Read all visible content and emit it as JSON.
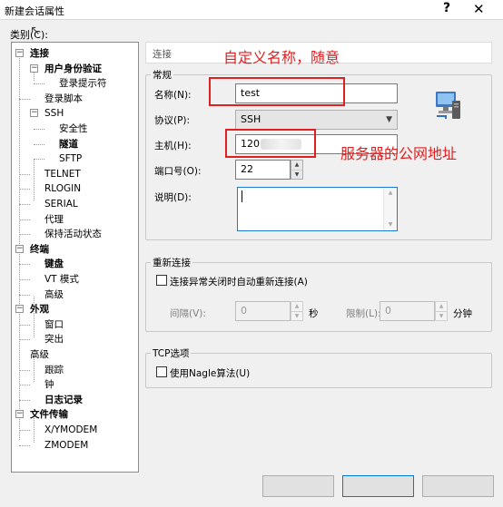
{
  "window": {
    "title": "新建会话属性",
    "help_glyph": "?",
    "close_glyph": "✕"
  },
  "category_label": "类别(C):",
  "tree": {
    "items": [
      {
        "label": "连接",
        "bold": true
      },
      {
        "label": "用户身份验证",
        "bold": true
      },
      {
        "label": "登录提示符",
        "bold": false
      },
      {
        "label": "登录脚本",
        "bold": false
      },
      {
        "label": "SSH",
        "bold": false
      },
      {
        "label": "安全性",
        "bold": false
      },
      {
        "label": "隧道",
        "bold": true
      },
      {
        "label": "SFTP",
        "bold": false
      },
      {
        "label": "TELNET",
        "bold": false
      },
      {
        "label": "RLOGIN",
        "bold": false
      },
      {
        "label": "SERIAL",
        "bold": false
      },
      {
        "label": "代理",
        "bold": false
      },
      {
        "label": "保持活动状态",
        "bold": false
      },
      {
        "label": "终端",
        "bold": true
      },
      {
        "label": "键盘",
        "bold": true
      },
      {
        "label": "VT 模式",
        "bold": false
      },
      {
        "label": "高级",
        "bold": false
      },
      {
        "label": "外观",
        "bold": true
      },
      {
        "label": "窗口",
        "bold": false
      },
      {
        "label": "突出",
        "bold": false
      },
      {
        "label": "高级",
        "bold": false
      },
      {
        "label": "跟踪",
        "bold": false
      },
      {
        "label": "钟",
        "bold": false
      },
      {
        "label": "日志记录",
        "bold": true
      },
      {
        "label": "文件传输",
        "bold": true
      },
      {
        "label": "X/YMODEM",
        "bold": false
      },
      {
        "label": "ZMODEM",
        "bold": false
      }
    ]
  },
  "panel_header": "连接",
  "general": {
    "group_label": "常规",
    "name_label": "名称(N):",
    "name_value": "test",
    "protocol_label": "协议(P):",
    "protocol_value": "SSH",
    "host_label": "主机(H):",
    "host_value": "120",
    "port_label": "端口号(O):",
    "port_value": "22",
    "desc_label": "说明(D):",
    "desc_value": ""
  },
  "reconnect": {
    "group_label": "重新连接",
    "checkbox_label": "连接异常关闭时自动重新连接(A)",
    "checked": false,
    "interval_label": "间隔(V):",
    "interval_value": "0",
    "interval_unit": "秒",
    "limit_label": "限制(L):",
    "limit_value": "0",
    "limit_unit": "分钟"
  },
  "tcp": {
    "group_label": "TCP选项",
    "checkbox_label": "使用Nagle算法(U)",
    "checked": false
  },
  "annotations": {
    "name_note": "自定义名称，随意",
    "host_note": "服务器的公网地址",
    "color": "#e02020"
  },
  "icons": {
    "network": "network-computer-icon",
    "help": "help-icon",
    "close": "close-icon"
  }
}
